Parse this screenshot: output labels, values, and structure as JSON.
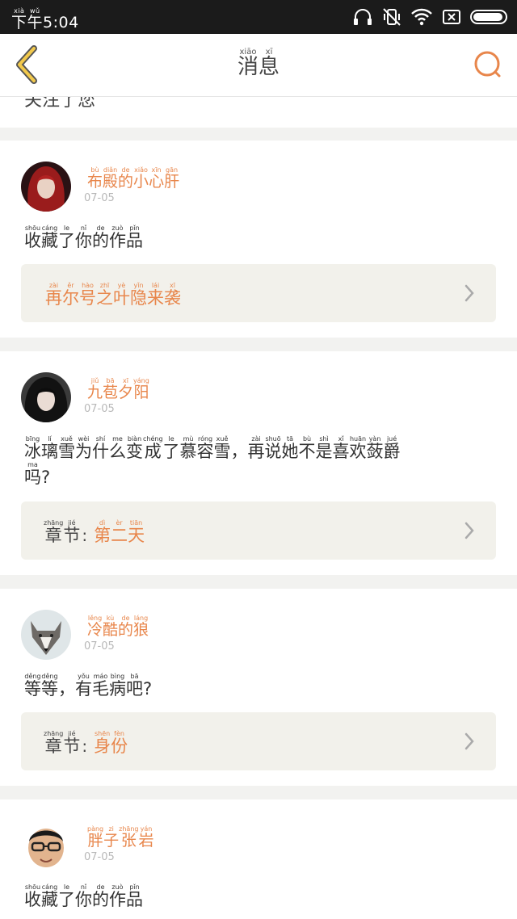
{
  "status_bar": {
    "time_prefix_ruby": [
      "xià",
      "wǔ"
    ],
    "time_prefix": [
      "下",
      "午"
    ],
    "time": "5:04"
  },
  "header": {
    "title": [
      {
        "py": "xiāo",
        "hz": "消"
      },
      {
        "py": "xī",
        "hz": "息"
      }
    ]
  },
  "partial_item": {
    "text_fragment": "关注了您"
  },
  "notifications": [
    {
      "user": [
        {
          "py": "bù",
          "hz": "布"
        },
        {
          "py": "diǎn",
          "hz": "殿"
        },
        {
          "py": "de",
          "hz": "的"
        },
        {
          "py": "xiǎo",
          "hz": "小"
        },
        {
          "py": "xīn",
          "hz": "心"
        },
        {
          "py": "gān",
          "hz": "肝"
        }
      ],
      "date": "07-05",
      "message": [
        {
          "py": "shōu",
          "hz": "收"
        },
        {
          "py": "cáng",
          "hz": "藏"
        },
        {
          "py": "le",
          "hz": "了"
        },
        {
          "py": "nǐ",
          "hz": "你"
        },
        {
          "py": "de",
          "hz": "的"
        },
        {
          "py": "zuò",
          "hz": "作"
        },
        {
          "py": "pǐn",
          "hz": "品"
        }
      ],
      "work": [
        {
          "py": "zài",
          "hz": "再"
        },
        {
          "py": "ěr",
          "hz": "尔"
        },
        {
          "py": "hào",
          "hz": "号"
        },
        {
          "py": "zhī",
          "hz": "之"
        },
        {
          "py": "yè",
          "hz": "叶"
        },
        {
          "py": "yǐn",
          "hz": "隐"
        },
        {
          "py": "lái",
          "hz": "来"
        },
        {
          "py": "xī",
          "hz": "袭"
        }
      ]
    },
    {
      "user": [
        {
          "py": "jiǔ",
          "hz": "九"
        },
        {
          "py": "bā",
          "hz": "苞"
        },
        {
          "py": "xī",
          "hz": "夕"
        },
        {
          "py": "yáng",
          "hz": "阳"
        }
      ],
      "date": "07-05",
      "message": [
        {
          "py": "bīng",
          "hz": "冰"
        },
        {
          "py": "lí",
          "hz": "璃"
        },
        {
          "py": "xuě",
          "hz": "雪"
        },
        {
          "py": "wèi",
          "hz": "为"
        },
        {
          "py": "shí",
          "hz": "什"
        },
        {
          "py": "me",
          "hz": "么"
        },
        {
          "py": "biàn",
          "hz": "变"
        },
        {
          "py": "chéng",
          "hz": "成"
        },
        {
          "py": "le",
          "hz": "了"
        },
        {
          "py": "mù",
          "hz": "慕"
        },
        {
          "py": "róng",
          "hz": "容"
        },
        {
          "py": "xuě",
          "hz": "雪"
        },
        {
          "py": "",
          "hz": "，"
        },
        {
          "py": "zài",
          "hz": "再"
        },
        {
          "py": "shuō",
          "hz": "说"
        },
        {
          "py": "tā",
          "hz": "她"
        },
        {
          "py": "bù",
          "hz": "不"
        },
        {
          "py": "shì",
          "hz": "是"
        },
        {
          "py": "xǐ",
          "hz": "喜"
        },
        {
          "py": "huān",
          "hz": "欢"
        },
        {
          "py": "yàn",
          "hz": "蔹"
        },
        {
          "py": "jué",
          "hz": "爵"
        },
        {
          "py": "ma",
          "hz": "吗"
        },
        {
          "py": "",
          "hz": "?"
        }
      ],
      "chapter_label": [
        {
          "py": "zhāng",
          "hz": "章"
        },
        {
          "py": "jié",
          "hz": "节"
        }
      ],
      "chapter_colon": ":",
      "chapter": [
        {
          "py": "dì",
          "hz": "第"
        },
        {
          "py": "èr",
          "hz": "二"
        },
        {
          "py": "tiān",
          "hz": "天"
        }
      ]
    },
    {
      "user": [
        {
          "py": "lěng",
          "hz": "冷"
        },
        {
          "py": "kù",
          "hz": "酷"
        },
        {
          "py": "de",
          "hz": "的"
        },
        {
          "py": "láng",
          "hz": "狼"
        }
      ],
      "date": "07-05",
      "message": [
        {
          "py": "děng",
          "hz": "等"
        },
        {
          "py": "děng",
          "hz": "等"
        },
        {
          "py": "",
          "hz": "，"
        },
        {
          "py": "yǒu",
          "hz": "有"
        },
        {
          "py": "máo",
          "hz": "毛"
        },
        {
          "py": "bìng",
          "hz": "病"
        },
        {
          "py": "bā",
          "hz": "吧"
        },
        {
          "py": "",
          "hz": "?"
        }
      ],
      "chapter_label": [
        {
          "py": "zhāng",
          "hz": "章"
        },
        {
          "py": "jié",
          "hz": "节"
        }
      ],
      "chapter_colon": ":",
      "chapter": [
        {
          "py": "shēn",
          "hz": "身"
        },
        {
          "py": "fèn",
          "hz": "份"
        }
      ]
    },
    {
      "user": [
        {
          "py": "pàng",
          "hz": "胖"
        },
        {
          "py": "zi",
          "hz": "子"
        },
        {
          "py": "zhāng",
          "hz": "张"
        },
        {
          "py": "yán",
          "hz": "岩"
        }
      ],
      "date": "07-05",
      "message": [
        {
          "py": "shōu",
          "hz": "收"
        },
        {
          "py": "cáng",
          "hz": "藏"
        },
        {
          "py": "le",
          "hz": "了"
        },
        {
          "py": "nǐ",
          "hz": "你"
        },
        {
          "py": "de",
          "hz": "的"
        },
        {
          "py": "zuò",
          "hz": "作"
        },
        {
          "py": "pǐn",
          "hz": "品"
        }
      ]
    }
  ],
  "colors": {
    "accent": "#e8864b",
    "back_arrow": "#f2c94c",
    "ref_bg": "#f2f1eb",
    "divider_bg": "#f2f2f0"
  }
}
